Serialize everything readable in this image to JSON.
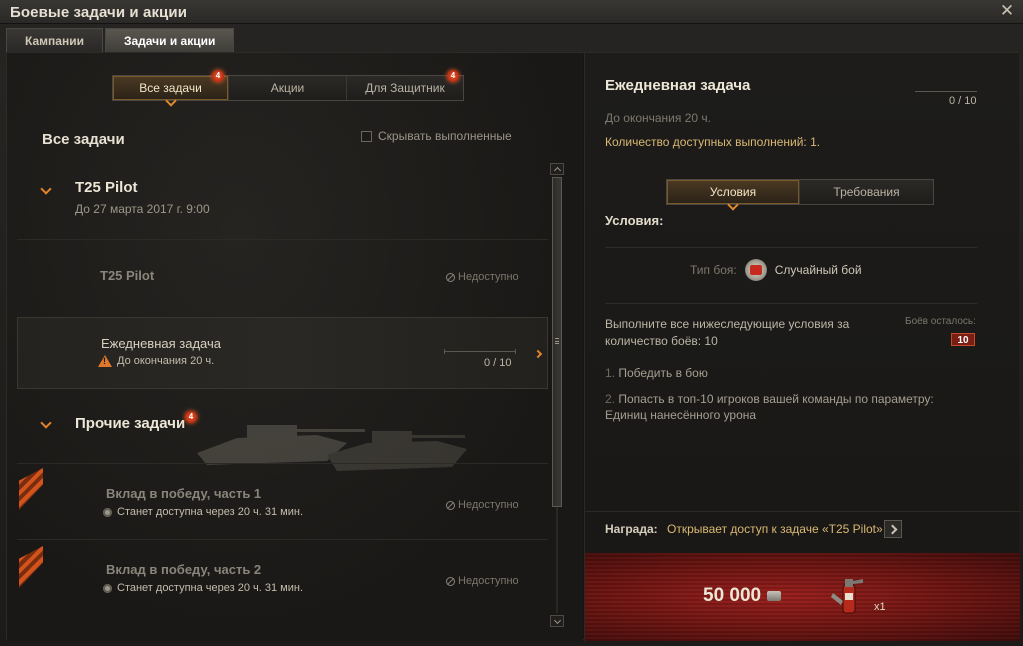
{
  "window": {
    "title": "Боевые задачи и акции"
  },
  "main_tabs": [
    {
      "label": "Кампании",
      "active": false
    },
    {
      "label": "Задачи и акции",
      "active": true
    }
  ],
  "filter": {
    "buttons": [
      {
        "label": "Все задачи",
        "active": true,
        "badge": "4"
      },
      {
        "label": "Акции",
        "active": false,
        "badge": ""
      },
      {
        "label": "Для Защитник",
        "active": false,
        "badge": "4"
      }
    ]
  },
  "left": {
    "section_title": "Все задачи",
    "hide_completed_label": "Скрывать выполненные"
  },
  "groups": [
    {
      "title": "T25 Pilot",
      "subtitle": "До 27 марта 2017 г. 9:00",
      "tasks": [
        {
          "title": "T25 Pilot",
          "status": "Недоступно"
        },
        {
          "title": "Ежедневная задача",
          "sub": "До окончания 20 ч.",
          "progress": "0 / 10",
          "selected": true
        }
      ]
    },
    {
      "title": "Прочие задачи",
      "badge": "4",
      "tasks": [
        {
          "title": "Вклад в победу, часть 1",
          "sub": "Станет доступна через 20 ч. 31 мин.",
          "status": "Недоступно"
        },
        {
          "title": "Вклад в победу, часть 2",
          "sub": "Станет доступна через 20 ч. 31 мин.",
          "status": "Недоступно"
        }
      ]
    }
  ],
  "detail": {
    "title": "Ежедневная задача",
    "progress": "0 / 10",
    "deadline": "До окончания 20 ч.",
    "available": "Количество доступных выполнений: 1.",
    "tabs": [
      {
        "label": "Условия",
        "active": true
      },
      {
        "label": "Требования",
        "active": false
      }
    ],
    "conditions_label": "Условия:",
    "battle_type_label": "Тип боя:",
    "battle_type_value": "Случайный бой",
    "description": "Выполните все нижеследующие условия за количество боёв: 10",
    "battles_left_label": "Боёв осталось:",
    "battles_left_value": "10",
    "conditions": [
      {
        "num": "1.",
        "text": "Победить в бою"
      },
      {
        "num": "2.",
        "text": "Попасть в топ-10 игроков вашей команды по параметру: Единиц нанесённого урона"
      }
    ],
    "reward_label": "Награда:",
    "reward_text": "Открывает доступ к задаче «T25 Pilot»",
    "credits": "50 000",
    "item_qty": "x1"
  },
  "icons": {
    "close": "close-icon",
    "unavailable": "no-entry-icon",
    "warning": "warning-icon",
    "clock": "clock-icon",
    "battle_type": "random-battle-icon",
    "credits": "credits-icon",
    "consumable": "fire-extinguisher-icon"
  },
  "colors": {
    "accent": "#e2822a",
    "gold": "#d9b873",
    "badge": "#e04a22"
  }
}
